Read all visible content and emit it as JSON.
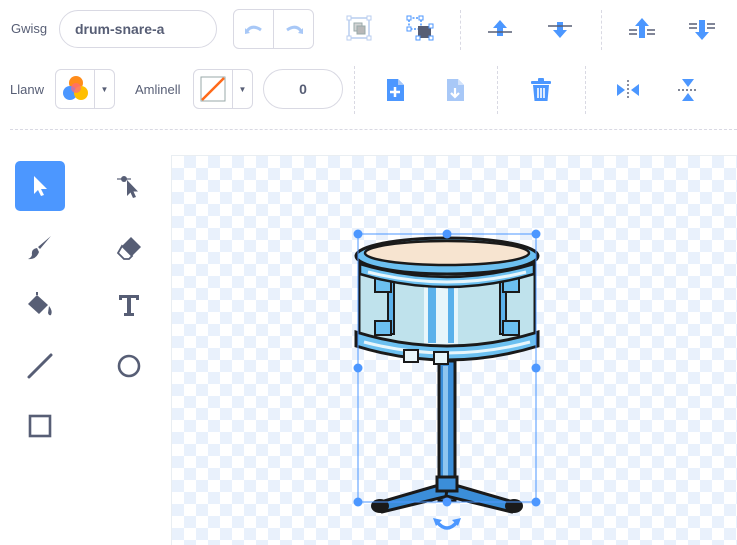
{
  "costume": {
    "label": "Gwisg",
    "name": "drum-snare-a"
  },
  "fill": {
    "label": "Llanw"
  },
  "outline": {
    "label": "Amlinell",
    "width": "0"
  },
  "colors": {
    "accent": "#4c97ff",
    "text": "#575e75",
    "delete": "#4c97ff"
  },
  "toolbar": {
    "undo_icon": "undo-icon",
    "redo_icon": "redo-icon",
    "group_icon": "group-icon",
    "ungroup_icon": "ungroup-icon",
    "forward_icon": "forward-icon",
    "backward_icon": "backward-icon",
    "front_icon": "front-icon",
    "back_icon": "back-icon",
    "copy_icon": "copy-icon",
    "paste_icon": "paste-icon",
    "delete_icon": "trash-icon",
    "flip_h_icon": "flip-horizontal-icon",
    "flip_v_icon": "flip-vertical-icon"
  },
  "tools": [
    "select",
    "reshape",
    "brush",
    "eraser",
    "fill",
    "text",
    "line",
    "circle",
    "rectangle"
  ]
}
